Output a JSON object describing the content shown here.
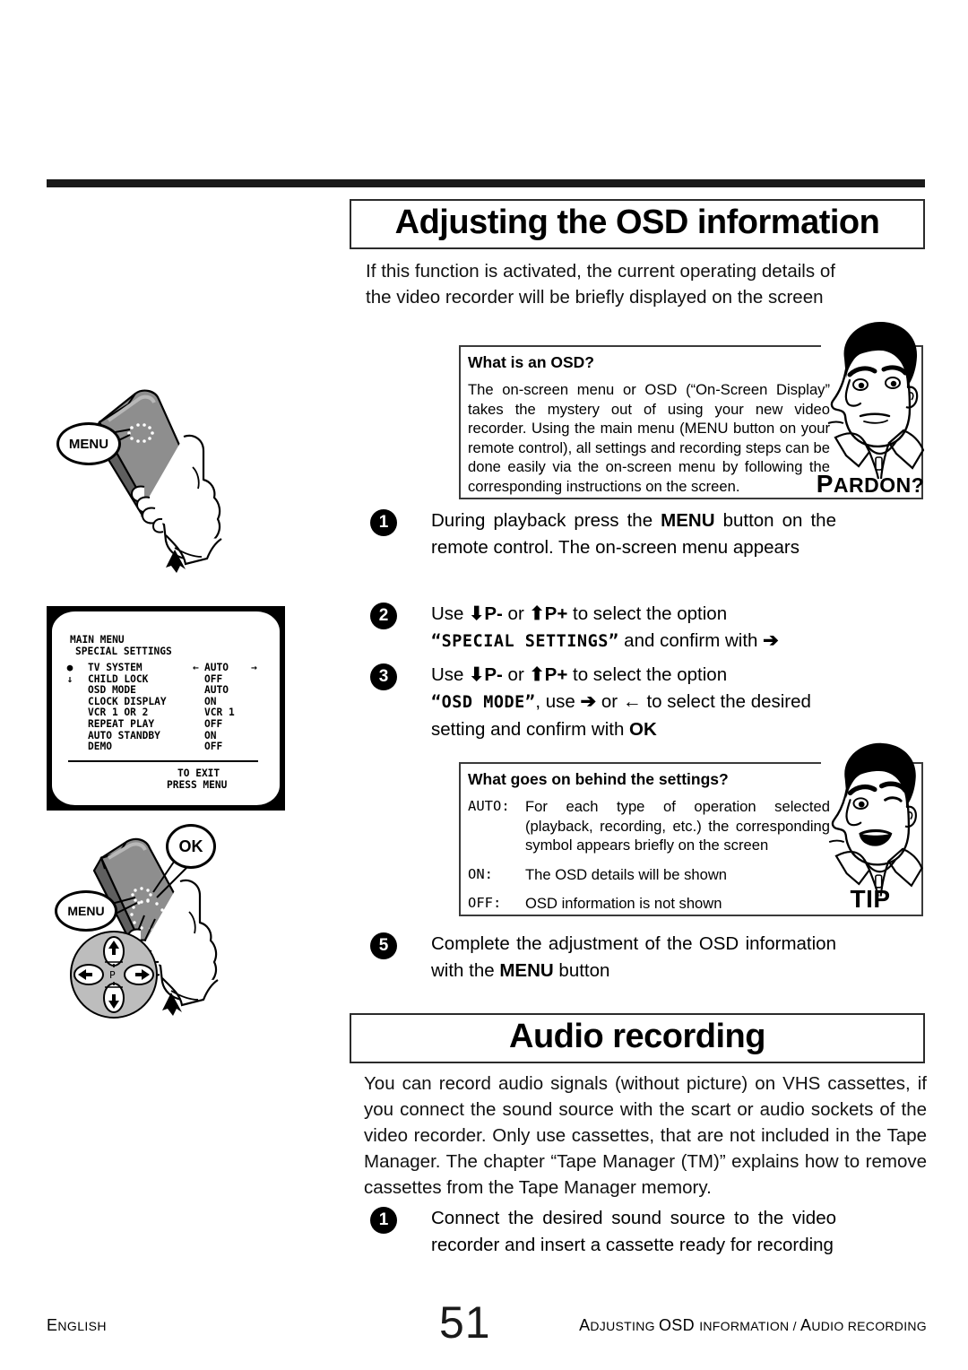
{
  "page": {
    "language": "ENGLISH",
    "number": "51",
    "breadcrumb_parts": {
      "a1": "A",
      "a_rest": "DJUSTING ",
      "b1": "OSD ",
      "b_rest": "INFORMATION / ",
      "c1": "A",
      "c_rest": "UDIO RECORDING"
    },
    "breadcrumb": "ADJUSTING OSD INFORMATION / AUDIO RECORDING"
  },
  "sections": {
    "osd": {
      "heading": "Adjusting the OSD information",
      "intro": "If this function is activated, the current operating details of the video recorder will be briefly displayed on the screen"
    },
    "audio": {
      "heading": "Audio recording",
      "intro": "You can record audio signals (without picture) on VHS cassettes, if you connect the sound source with the scart or audio sockets of the video recorder. Only use cassettes, that are not included in the Tape Manager. The chapter “Tape Manager (TM)” explains how to remove cassettes from the Tape Manager memory."
    }
  },
  "steps": {
    "s1": {
      "num": "1",
      "pre": "During playback press the ",
      "key": "MENU",
      "post": " button on the remote control. The on-screen menu appears"
    },
    "s2": {
      "num": "2",
      "pre": "Use ",
      "key_down": "P-",
      "mid": " or ",
      "key_up": "P+",
      "post": " to select the option ",
      "option": "“SPECIAL SETTINGS”",
      "tail": " and confirm with ",
      "arrow": "➔"
    },
    "s3": {
      "num": "3",
      "pre": "Use ",
      "key_down": "P-",
      "mid": " or ",
      "key_up": "P+",
      "post": " to select the option ",
      "option": "“OSD MODE”",
      "tail": ", use ",
      "arrow_right": "➔",
      "mid2": " or ",
      "arrow_left": "←",
      "tail2": " to select the desired setting and confirm with ",
      "key_ok": "OK"
    },
    "s5": {
      "num": "5",
      "pre": "Complete the adjustment of the OSD information with the ",
      "key": "MENU",
      "post": " button"
    },
    "a1": {
      "num": "1",
      "text": "Connect the desired sound source to the video recorder and insert a cassette ready for recording"
    }
  },
  "boxes": {
    "pardon": {
      "title": "What is an OSD?",
      "body": "The on-screen menu or OSD (“On-Screen Display” takes the mystery out of using your new video recorder. Using the main menu (MENU button on your remote control), all settings and recording steps can be done easily via the on-screen menu by following the corresponding instructions on the screen.",
      "caption_first": "P",
      "caption_rest": "ARDON?"
    },
    "tip": {
      "title": "What goes on behind the settings?",
      "rows": [
        {
          "key": "AUTO:",
          "value": "For each type of operation selected (playback, recording, etc.) the corresponding symbol appears briefly on the screen"
        },
        {
          "key": "ON:",
          "value": "The OSD details will be shown"
        },
        {
          "key": "OFF:",
          "value": "OSD information is not shown"
        }
      ],
      "caption": "TIP"
    }
  },
  "osd_screen": {
    "header_line1": "MAIN MENU",
    "header_line2": "SPECIAL SETTINGS",
    "rows": [
      {
        "marker": "●",
        "label": "TV SYSTEM",
        "value": "AUTO",
        "left_arrow": "←",
        "right_arrow": "→"
      },
      {
        "marker": "↓",
        "label": "CHILD LOCK",
        "value": "OFF",
        "left_arrow": "",
        "right_arrow": ""
      },
      {
        "marker": "",
        "label": "OSD MODE",
        "value": "AUTO",
        "left_arrow": "",
        "right_arrow": ""
      },
      {
        "marker": "",
        "label": "CLOCK DISPLAY",
        "value": "ON",
        "left_arrow": "",
        "right_arrow": ""
      },
      {
        "marker": "",
        "label": "VCR 1 OR 2",
        "value": "VCR 1",
        "left_arrow": "",
        "right_arrow": ""
      },
      {
        "marker": "",
        "label": "REPEAT PLAY",
        "value": "OFF",
        "left_arrow": "",
        "right_arrow": ""
      },
      {
        "marker": "",
        "label": "AUTO STANDBY",
        "value": "ON",
        "left_arrow": "",
        "right_arrow": ""
      },
      {
        "marker": "",
        "label": "DEMO",
        "value": "OFF",
        "left_arrow": "",
        "right_arrow": ""
      }
    ],
    "exit_line1": "TO EXIT",
    "exit_line2": "PRESS MENU"
  },
  "illustrations": {
    "remote_menu": {
      "callout": "MENU"
    },
    "remote_ok": {
      "callout_ok": "OK",
      "callout_menu": "MENU",
      "dpad_center": "P",
      "dpad_up": "+",
      "dpad_down": "–"
    }
  }
}
